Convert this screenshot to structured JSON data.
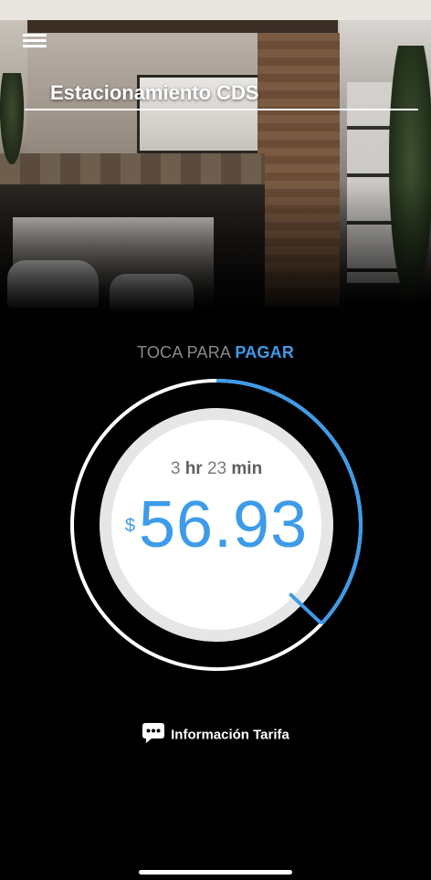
{
  "header": {
    "title": "Estacionamiento CDS",
    "menu_icon": "hamburger-menu-icon",
    "background": "house-parking-photo"
  },
  "payment": {
    "prompt_prefix": "TOCA PARA ",
    "prompt_action": "PAGAR",
    "elapsed_hours": "3",
    "hours_unit": "hr",
    "elapsed_minutes": "23",
    "minutes_unit": "min",
    "currency_symbol": "$",
    "amount": "56.93",
    "dial_progress_fraction": 0.37
  },
  "info": {
    "label": "Información Tarifa",
    "icon": "chat-bubble-icon"
  },
  "colors": {
    "accent": "#3d9be9",
    "background": "#000000",
    "dial_face": "#ffffff",
    "dial_inner_ring": "#e6e6e6"
  }
}
